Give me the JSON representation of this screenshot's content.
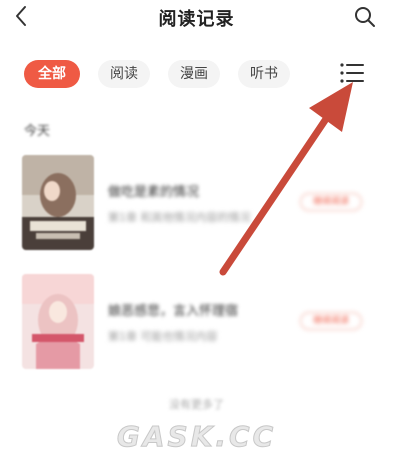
{
  "header": {
    "title": "阅读记录",
    "back_icon": "chevron-left-icon",
    "search_icon": "search-icon"
  },
  "filters": {
    "chips": [
      {
        "label": "全部",
        "active": true
      },
      {
        "label": "阅读",
        "active": false
      },
      {
        "label": "漫画",
        "active": false
      },
      {
        "label": "听书",
        "active": false
      }
    ],
    "menu_icon": "list-menu-icon"
  },
  "section": {
    "label": "今天"
  },
  "items": [
    {
      "title": "做吃是素的情况",
      "subtitle": "第1章 和其他情况内容的情况",
      "button": "继续阅读"
    },
    {
      "title": "娘恶感悲，言入怀理宿",
      "subtitle": "第1章 可能也情况内容",
      "button": "继续阅读"
    }
  ],
  "footer": {
    "hint": "没有更多了"
  },
  "watermark": "GASK.CC",
  "colors": {
    "accent": "#ef5a44",
    "arrow": "#c94a3a"
  }
}
